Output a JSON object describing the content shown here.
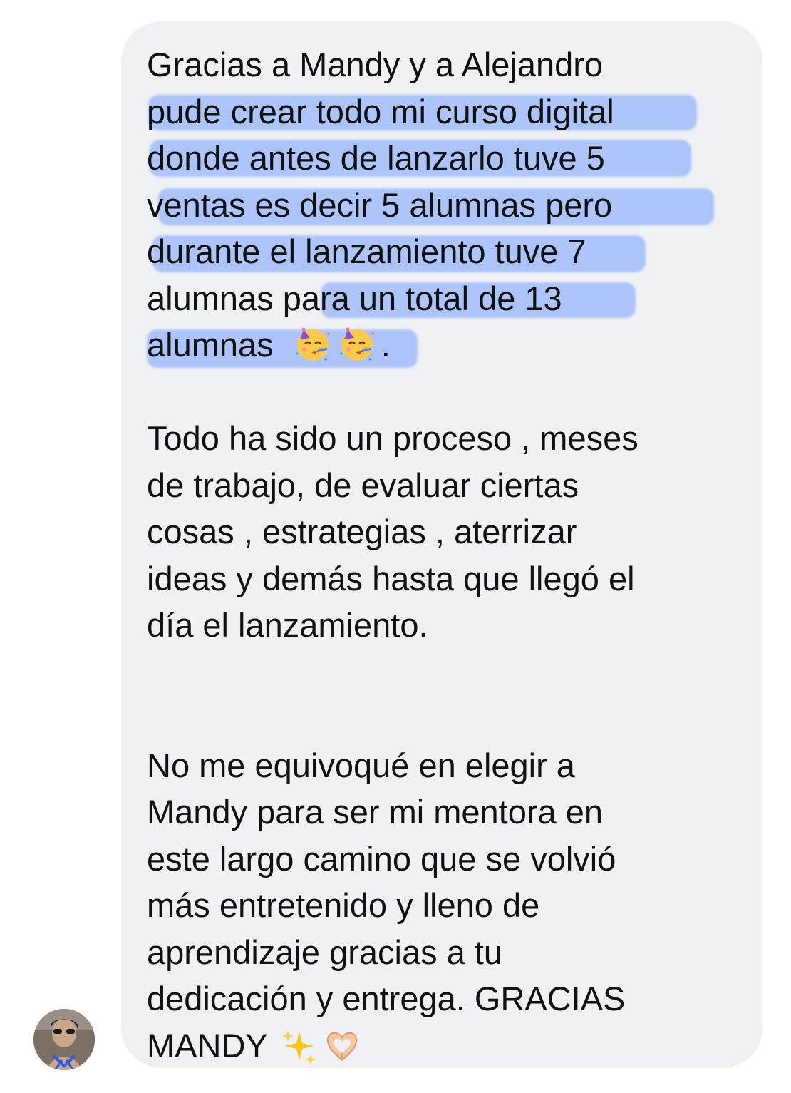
{
  "message": {
    "paragraph1": [
      "Gracias a Mandy y a Alejandro",
      "pude crear todo mi curso digital",
      "donde antes de lanzarlo tuve 5",
      "ventas es decir 5 alumnas pero",
      "durante el lanzamiento tuve 7",
      "alumnas para un total de 13",
      "alumnas",
      "."
    ],
    "paragraph2": [
      "Todo ha sido un proceso , meses",
      "de trabajo,  de evaluar ciertas",
      "cosas , estrategias , aterrizar",
      "ideas y demás hasta que llegó el",
      "día el lanzamiento."
    ],
    "paragraph3": [
      "No me equivoqué en elegir a",
      "Mandy para ser mi mentora en",
      "este largo camino que se volvió",
      "más entretenido y lleno de",
      "aprendizaje gracias a tu",
      "dedicación y entrega. GRACIAS",
      "MANDY"
    ],
    "emojis": [
      "partying-face",
      "partying-face",
      "sparkles",
      "heart-hands"
    ]
  },
  "colors": {
    "bubble": "#eff0f4",
    "text": "#111111",
    "highlight": "#5c8eff"
  }
}
